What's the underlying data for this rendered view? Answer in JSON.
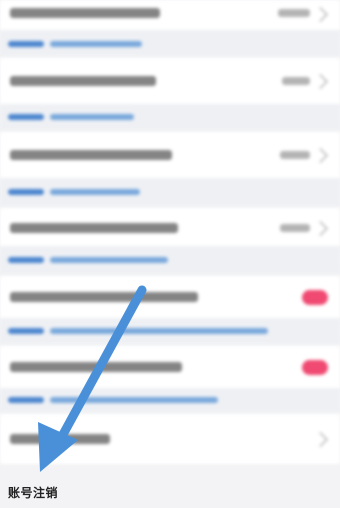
{
  "footer": {
    "label": "账号注销"
  },
  "rows": [
    {
      "control": "chevron"
    },
    {
      "control": "chevron"
    },
    {
      "control": "chevron"
    },
    {
      "control": "chevron"
    },
    {
      "control": "toggle",
      "state": "on"
    },
    {
      "control": "toggle",
      "state": "on"
    },
    {
      "control": "chevron"
    }
  ],
  "colors": {
    "toggle_on": "#f04a72",
    "link": "#4c86cf",
    "arrow": "#4a90d9"
  },
  "annotation": {
    "icon": "arrow-down-left-icon"
  }
}
